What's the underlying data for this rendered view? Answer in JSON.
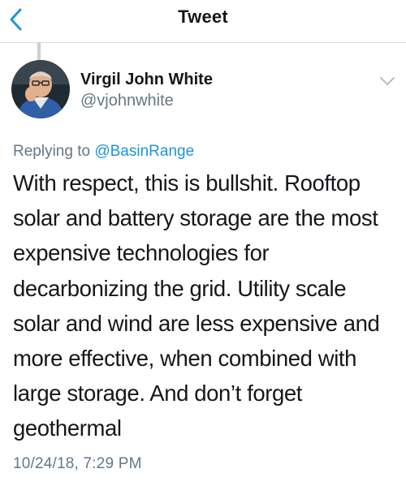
{
  "header": {
    "title": "Tweet",
    "back_icon": "chevron-left-icon",
    "accent_color": "#1b95e0"
  },
  "tweet": {
    "author_name": "Virgil John White",
    "author_handle": "@vjohnwhite",
    "avatar_icon": "profile-photo",
    "menu_icon": "chevron-down-icon",
    "replying_prefix": "Replying to ",
    "replying_to": "@BasinRange",
    "text": "With respect, this is bullshit. Rooftop solar and battery storage are the most expensive technologies for decarbonizing the grid. Utility scale solar and wind are less expensive and more effective, when combined with large storage. And don’t forget geothermal",
    "timestamp": "10/24/18, 7:29 PM"
  },
  "colors": {
    "text_primary": "#14171a",
    "text_secondary": "#657786",
    "link": "#1b95e0",
    "divider": "#dcdcdc"
  }
}
